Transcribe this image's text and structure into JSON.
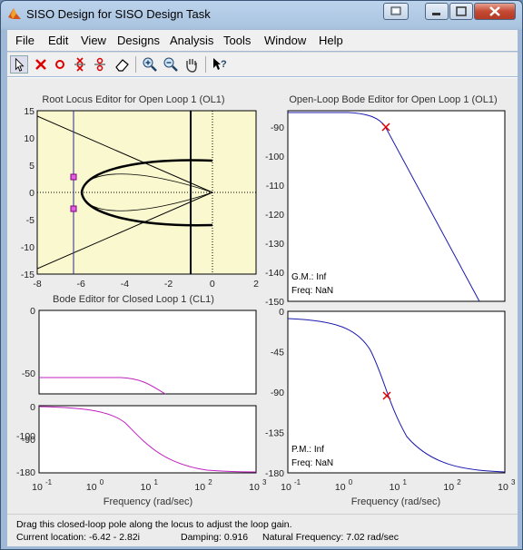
{
  "window": {
    "title": "SISO Design for SISO Design Task",
    "icon": "matlab-icon"
  },
  "menu": [
    "File",
    "Edit",
    "View",
    "Designs",
    "Analysis",
    "Tools",
    "Window",
    "Help"
  ],
  "toolbar": {
    "icons": [
      "pointer-icon",
      "delete-icon",
      "add-pole-icon",
      "add-zero-icon",
      "add-complex-pole-icon",
      "add-complex-zero-icon",
      "eraser-icon",
      "zoom-in-icon",
      "zoom-out-icon",
      "pan-icon",
      "whats-this-icon"
    ]
  },
  "plots": {
    "root_locus": {
      "title": "Root Locus Editor for Open Loop 1 (OL1)",
      "xticks": [
        "-8",
        "-6",
        "-4",
        "-2",
        "0",
        "2"
      ],
      "yticks": [
        "15",
        "10",
        "5",
        "0",
        "-5",
        "-10",
        "-15"
      ]
    },
    "ol_bode": {
      "title": "Open-Loop Bode Editor for Open Loop 1 (OL1)",
      "mag_yticks": [
        "-90",
        "-100",
        "-110",
        "-120",
        "-130",
        "-140",
        "-150"
      ],
      "phase_yticks": [
        "0",
        "-45",
        "-90",
        "-135",
        "-180"
      ],
      "gm": "G.M.: Inf",
      "gm_freq": "Freq: NaN",
      "pm": "P.M.: Inf",
      "pm_freq": "Freq: NaN",
      "xlabel": "Frequency (rad/sec)"
    },
    "cl_bode": {
      "title": "Bode Editor for Closed Loop 1 (CL1)",
      "mag_yticks": [
        "0",
        "-50",
        "-100"
      ],
      "phase_yticks": [
        "0",
        "-90",
        "-180"
      ],
      "xlabel": "Frequency (rad/sec)"
    },
    "freq_ticks": [
      "10",
      "10",
      "10",
      "10",
      "10"
    ],
    "freq_exponents": [
      "-1",
      "0",
      "1",
      "2",
      "3"
    ]
  },
  "status": {
    "hint": "Drag this closed-loop pole along the locus to adjust the loop gain.",
    "location": "Current location: -6.42 - 2.82i",
    "damping": "Damping: 0.916",
    "natural_freq": "Natural Frequency: 7.02 rad/sec"
  }
}
